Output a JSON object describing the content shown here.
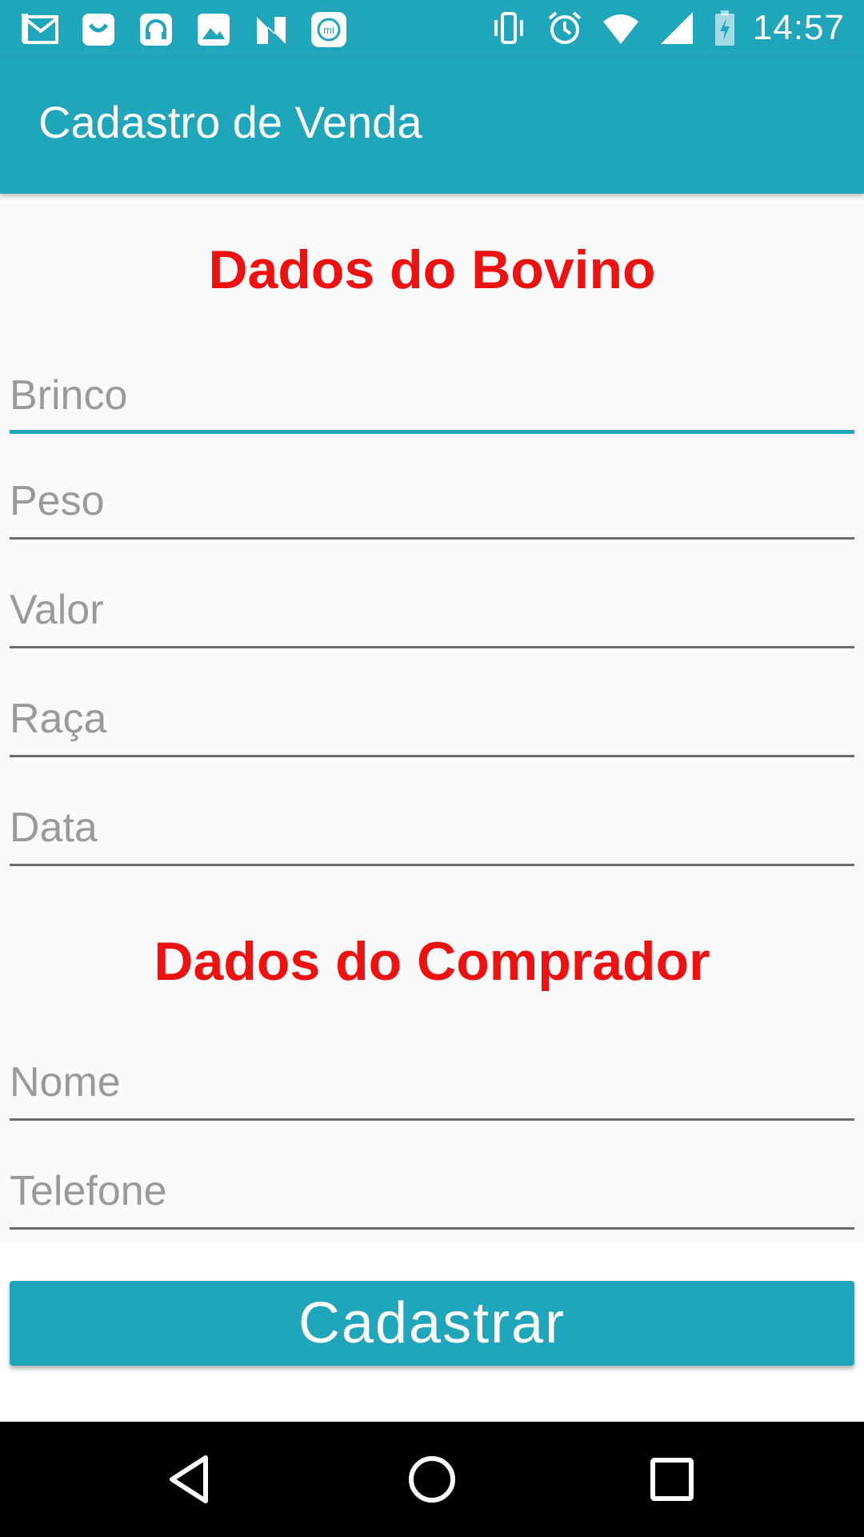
{
  "status_bar": {
    "time": "14:57",
    "left_icons": [
      "gmail-icon",
      "cart-icon",
      "headset-icon",
      "gallery-icon",
      "n-icon",
      "mi-icon"
    ],
    "right_icons": [
      "vibrate-icon",
      "alarm-icon",
      "wifi-icon",
      "signal-icon",
      "battery-charging-icon"
    ]
  },
  "app_bar": {
    "title": "Cadastro de Venda"
  },
  "sections": {
    "bovino_title": "Dados do Bovino",
    "comprador_title": "Dados do Comprador"
  },
  "fields": {
    "brinco": {
      "placeholder": "Brinco",
      "value": ""
    },
    "peso": {
      "placeholder": "Peso",
      "value": ""
    },
    "valor": {
      "placeholder": "Valor",
      "value": ""
    },
    "raca": {
      "placeholder": "Raça",
      "value": ""
    },
    "data": {
      "placeholder": "Data",
      "value": ""
    },
    "nome": {
      "placeholder": "Nome",
      "value": ""
    },
    "telefone": {
      "placeholder": "Telefone",
      "value": ""
    }
  },
  "submit_button": {
    "label": "Cadastrar"
  },
  "colors": {
    "primary": "#20a6bb",
    "section_title": "#ee1111",
    "background": "#fafafa"
  },
  "nav_bar": {
    "buttons": [
      "back-icon",
      "home-icon",
      "recents-icon"
    ]
  }
}
